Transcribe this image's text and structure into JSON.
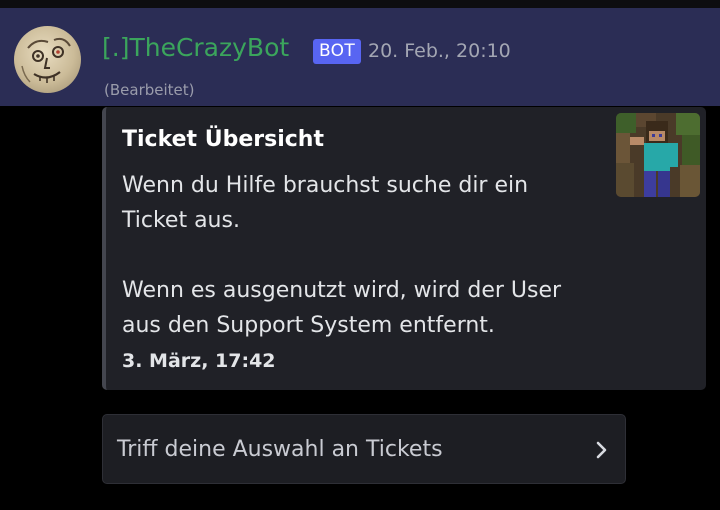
{
  "message": {
    "author": {
      "name": "[.]TheCrazyBot",
      "name_color": "#3ba55c",
      "badge": "BOT",
      "badge_color": "#5865f2",
      "avatar_icon": "doodle-face-avatar"
    },
    "timestamp": "20. Feb., 20:10",
    "edited_label": "(Bearbeitet)"
  },
  "embed": {
    "title": "Ticket Übersicht",
    "description_paragraphs": [
      "Wenn du Hilfe brauchst suche dir ein Ticket aus.",
      "Wenn es ausgenutzt wird, wird der User aus den Support System entfernt."
    ],
    "footer_time": "3. März, 17:42",
    "thumbnail_icon": "minecraft-character-thumbnail"
  },
  "select_menu": {
    "placeholder": "Triff deine Auswahl an Tickets",
    "icon": "chevron-right-icon"
  }
}
